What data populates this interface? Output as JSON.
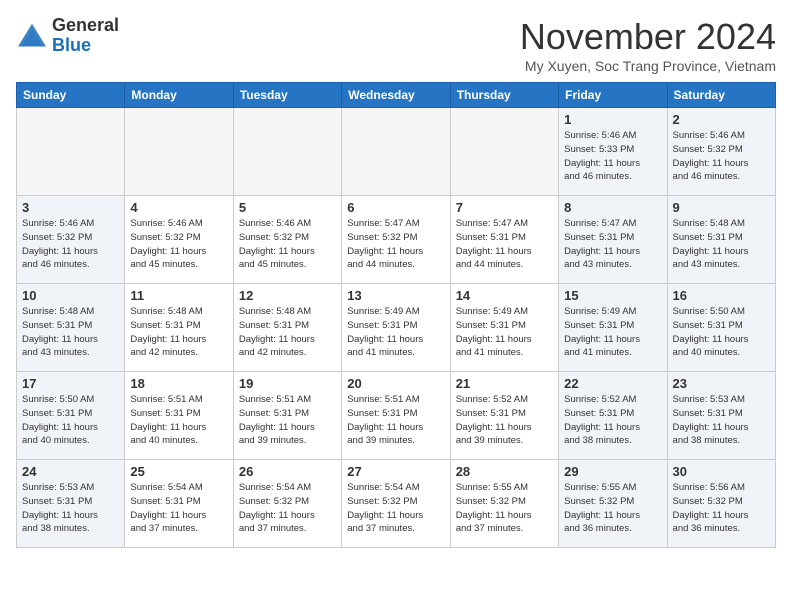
{
  "header": {
    "logo_general": "General",
    "logo_blue": "Blue",
    "month_title": "November 2024",
    "subtitle": "My Xuyen, Soc Trang Province, Vietnam"
  },
  "days_of_week": [
    "Sunday",
    "Monday",
    "Tuesday",
    "Wednesday",
    "Thursday",
    "Friday",
    "Saturday"
  ],
  "weeks": [
    [
      {
        "day": "",
        "info": "",
        "empty": true
      },
      {
        "day": "",
        "info": "",
        "empty": true
      },
      {
        "day": "",
        "info": "",
        "empty": true
      },
      {
        "day": "",
        "info": "",
        "empty": true
      },
      {
        "day": "",
        "info": "",
        "empty": true
      },
      {
        "day": "1",
        "info": "Sunrise: 5:46 AM\nSunset: 5:33 PM\nDaylight: 11 hours\nand 46 minutes.",
        "weekend": true
      },
      {
        "day": "2",
        "info": "Sunrise: 5:46 AM\nSunset: 5:32 PM\nDaylight: 11 hours\nand 46 minutes.",
        "weekend": true
      }
    ],
    [
      {
        "day": "3",
        "info": "Sunrise: 5:46 AM\nSunset: 5:32 PM\nDaylight: 11 hours\nand 46 minutes.",
        "weekend": true
      },
      {
        "day": "4",
        "info": "Sunrise: 5:46 AM\nSunset: 5:32 PM\nDaylight: 11 hours\nand 45 minutes."
      },
      {
        "day": "5",
        "info": "Sunrise: 5:46 AM\nSunset: 5:32 PM\nDaylight: 11 hours\nand 45 minutes."
      },
      {
        "day": "6",
        "info": "Sunrise: 5:47 AM\nSunset: 5:32 PM\nDaylight: 11 hours\nand 44 minutes."
      },
      {
        "day": "7",
        "info": "Sunrise: 5:47 AM\nSunset: 5:31 PM\nDaylight: 11 hours\nand 44 minutes."
      },
      {
        "day": "8",
        "info": "Sunrise: 5:47 AM\nSunset: 5:31 PM\nDaylight: 11 hours\nand 43 minutes.",
        "weekend": true
      },
      {
        "day": "9",
        "info": "Sunrise: 5:48 AM\nSunset: 5:31 PM\nDaylight: 11 hours\nand 43 minutes.",
        "weekend": true
      }
    ],
    [
      {
        "day": "10",
        "info": "Sunrise: 5:48 AM\nSunset: 5:31 PM\nDaylight: 11 hours\nand 43 minutes.",
        "weekend": true
      },
      {
        "day": "11",
        "info": "Sunrise: 5:48 AM\nSunset: 5:31 PM\nDaylight: 11 hours\nand 42 minutes."
      },
      {
        "day": "12",
        "info": "Sunrise: 5:48 AM\nSunset: 5:31 PM\nDaylight: 11 hours\nand 42 minutes."
      },
      {
        "day": "13",
        "info": "Sunrise: 5:49 AM\nSunset: 5:31 PM\nDaylight: 11 hours\nand 41 minutes."
      },
      {
        "day": "14",
        "info": "Sunrise: 5:49 AM\nSunset: 5:31 PM\nDaylight: 11 hours\nand 41 minutes."
      },
      {
        "day": "15",
        "info": "Sunrise: 5:49 AM\nSunset: 5:31 PM\nDaylight: 11 hours\nand 41 minutes.",
        "weekend": true
      },
      {
        "day": "16",
        "info": "Sunrise: 5:50 AM\nSunset: 5:31 PM\nDaylight: 11 hours\nand 40 minutes.",
        "weekend": true
      }
    ],
    [
      {
        "day": "17",
        "info": "Sunrise: 5:50 AM\nSunset: 5:31 PM\nDaylight: 11 hours\nand 40 minutes.",
        "weekend": true
      },
      {
        "day": "18",
        "info": "Sunrise: 5:51 AM\nSunset: 5:31 PM\nDaylight: 11 hours\nand 40 minutes."
      },
      {
        "day": "19",
        "info": "Sunrise: 5:51 AM\nSunset: 5:31 PM\nDaylight: 11 hours\nand 39 minutes."
      },
      {
        "day": "20",
        "info": "Sunrise: 5:51 AM\nSunset: 5:31 PM\nDaylight: 11 hours\nand 39 minutes."
      },
      {
        "day": "21",
        "info": "Sunrise: 5:52 AM\nSunset: 5:31 PM\nDaylight: 11 hours\nand 39 minutes."
      },
      {
        "day": "22",
        "info": "Sunrise: 5:52 AM\nSunset: 5:31 PM\nDaylight: 11 hours\nand 38 minutes.",
        "weekend": true
      },
      {
        "day": "23",
        "info": "Sunrise: 5:53 AM\nSunset: 5:31 PM\nDaylight: 11 hours\nand 38 minutes.",
        "weekend": true
      }
    ],
    [
      {
        "day": "24",
        "info": "Sunrise: 5:53 AM\nSunset: 5:31 PM\nDaylight: 11 hours\nand 38 minutes.",
        "weekend": true
      },
      {
        "day": "25",
        "info": "Sunrise: 5:54 AM\nSunset: 5:31 PM\nDaylight: 11 hours\nand 37 minutes."
      },
      {
        "day": "26",
        "info": "Sunrise: 5:54 AM\nSunset: 5:32 PM\nDaylight: 11 hours\nand 37 minutes."
      },
      {
        "day": "27",
        "info": "Sunrise: 5:54 AM\nSunset: 5:32 PM\nDaylight: 11 hours\nand 37 minutes."
      },
      {
        "day": "28",
        "info": "Sunrise: 5:55 AM\nSunset: 5:32 PM\nDaylight: 11 hours\nand 37 minutes."
      },
      {
        "day": "29",
        "info": "Sunrise: 5:55 AM\nSunset: 5:32 PM\nDaylight: 11 hours\nand 36 minutes.",
        "weekend": true
      },
      {
        "day": "30",
        "info": "Sunrise: 5:56 AM\nSunset: 5:32 PM\nDaylight: 11 hours\nand 36 minutes.",
        "weekend": true
      }
    ]
  ]
}
